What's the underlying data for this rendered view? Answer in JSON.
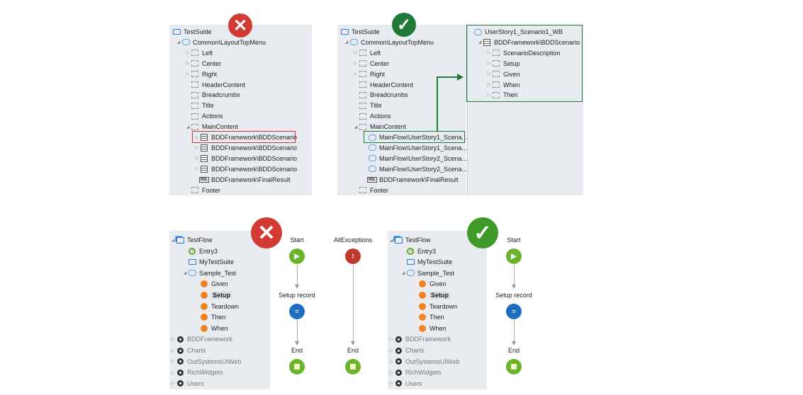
{
  "colors": {
    "wrong": "#d23a34",
    "right": "#1f7a3a",
    "highlight_wrong": "#c0393b",
    "highlight_right": "#1f7a3a",
    "start": "#6ab42c",
    "end": "#6ab42c",
    "assign": "#1f6fc0",
    "exception": "#c0392b"
  },
  "panel_top_wrong": {
    "status_icon": "x-icon",
    "rows": [
      {
        "label": "TestSuide",
        "level": 0,
        "icon": "monitor"
      },
      {
        "label": "Common\\LayoutTopMenu",
        "level": 1,
        "icon": "webblock",
        "arrow": "down"
      },
      {
        "label": "Left",
        "level": 2,
        "icon": "placeholder",
        "arrow": "right"
      },
      {
        "label": "Center",
        "level": 2,
        "icon": "placeholder",
        "arrow": "right"
      },
      {
        "label": "Right",
        "level": 2,
        "icon": "placeholder",
        "arrow": "right"
      },
      {
        "label": "HeaderContent",
        "level": 2,
        "icon": "placeholder"
      },
      {
        "label": "Breadcrumbs",
        "level": 2,
        "icon": "placeholder"
      },
      {
        "label": "Title",
        "level": 2,
        "icon": "placeholder"
      },
      {
        "label": "Actions",
        "level": 2,
        "icon": "placeholder"
      },
      {
        "label": "MainContent",
        "level": 2,
        "icon": "placeholder",
        "arrow": "down"
      },
      {
        "label": "BDDFramework\\BDDScenario",
        "level": 3,
        "icon": "document",
        "arrow": "right",
        "highlight": true
      },
      {
        "label": "BDDFramework\\BDDScenario",
        "level": 3,
        "icon": "document",
        "arrow": "right"
      },
      {
        "label": "BDDFramework\\BDDScenario",
        "level": 3,
        "icon": "document",
        "arrow": "right"
      },
      {
        "label": "BDDFramework\\BDDScenario",
        "level": 3,
        "icon": "document",
        "arrow": "right"
      },
      {
        "label": "BDDFramework\\FinalResult",
        "level": 3,
        "icon": "rsl"
      },
      {
        "label": "Footer",
        "level": 2,
        "icon": "placeholder"
      }
    ]
  },
  "panel_top_right": {
    "status_icon": "check-icon",
    "rows": [
      {
        "label": "TestSuide",
        "level": 0,
        "icon": "monitor"
      },
      {
        "label": "Common\\LayoutTopMenu",
        "level": 1,
        "icon": "webblock",
        "arrow": "down"
      },
      {
        "label": "Left",
        "level": 2,
        "icon": "placeholder",
        "arrow": "right"
      },
      {
        "label": "Center",
        "level": 2,
        "icon": "placeholder",
        "arrow": "right"
      },
      {
        "label": "Right",
        "level": 2,
        "icon": "placeholder",
        "arrow": "right"
      },
      {
        "label": "HeaderContent",
        "level": 2,
        "icon": "placeholder"
      },
      {
        "label": "Breadcrumbs",
        "level": 2,
        "icon": "placeholder"
      },
      {
        "label": "Title",
        "level": 2,
        "icon": "placeholder"
      },
      {
        "label": "Actions",
        "level": 2,
        "icon": "placeholder"
      },
      {
        "label": "MainContent",
        "level": 2,
        "icon": "placeholder",
        "arrow": "down"
      },
      {
        "label": "MainFlow\\UserStory1_Scena...",
        "level": 3,
        "icon": "webblock",
        "highlight": true
      },
      {
        "label": "MainFlow\\UserStory1_Scena...",
        "level": 3,
        "icon": "webblock"
      },
      {
        "label": "MainFlow\\UserStory2_Scena...",
        "level": 3,
        "icon": "webblock"
      },
      {
        "label": "MainFlow\\UserStory2_Scena...",
        "level": 3,
        "icon": "webblock"
      },
      {
        "label": "BDDFramework\\FinalResult",
        "level": 3,
        "icon": "rsl"
      },
      {
        "label": "Footer",
        "level": 2,
        "icon": "placeholder"
      }
    ]
  },
  "panel_top_detail": {
    "rows": [
      {
        "label": "UserStory1_Scenario1_WB",
        "level": 0,
        "icon": "webblock"
      },
      {
        "label": "BDDFramework\\BDDScenario",
        "level": 1,
        "icon": "document",
        "arrow": "down"
      },
      {
        "label": "ScenarioDescription",
        "level": 2,
        "icon": "placeholder",
        "arrow": "right"
      },
      {
        "label": "Setup",
        "level": 2,
        "icon": "placeholder",
        "arrow": "right"
      },
      {
        "label": "Given",
        "level": 2,
        "icon": "placeholder",
        "arrow": "right"
      },
      {
        "label": "When",
        "level": 2,
        "icon": "placeholder",
        "arrow": "right"
      },
      {
        "label": "Then",
        "level": 2,
        "icon": "placeholder",
        "arrow": "right"
      }
    ]
  },
  "bottom_tree": {
    "rows": [
      {
        "label": "TestFlow",
        "level": 0,
        "icon": "flow",
        "arrow": "down"
      },
      {
        "label": "Entry3",
        "level": 1,
        "icon": "entry"
      },
      {
        "label": "MyTestSuite",
        "level": 1,
        "icon": "monitor"
      },
      {
        "label": "Sample_Test",
        "level": 1,
        "icon": "webblock",
        "arrow": "down"
      },
      {
        "label": "Given",
        "level": 2,
        "icon": "orange"
      },
      {
        "label": "Setup",
        "level": 2,
        "icon": "orange",
        "selected": true
      },
      {
        "label": "Teardown",
        "level": 2,
        "icon": "orange"
      },
      {
        "label": "Then",
        "level": 2,
        "icon": "orange"
      },
      {
        "label": "When",
        "level": 2,
        "icon": "orange"
      },
      {
        "label": "BDDFramework",
        "level": 0,
        "icon": "module",
        "arrow": "right",
        "muted": true
      },
      {
        "label": "Charts",
        "level": 0,
        "icon": "module",
        "arrow": "right",
        "muted": true
      },
      {
        "label": "OutSystemsUIWeb",
        "level": 0,
        "icon": "module",
        "arrow": "right",
        "muted": true
      },
      {
        "label": "RichWidgets",
        "level": 0,
        "icon": "module",
        "arrow": "right",
        "muted": true
      },
      {
        "label": "Users",
        "level": 0,
        "icon": "module",
        "arrow": "right",
        "muted": true
      }
    ]
  },
  "flow": {
    "start": "Start",
    "setup": "Setup record",
    "end": "End",
    "exceptions": "AllExceptions",
    "exception_end": "End"
  }
}
